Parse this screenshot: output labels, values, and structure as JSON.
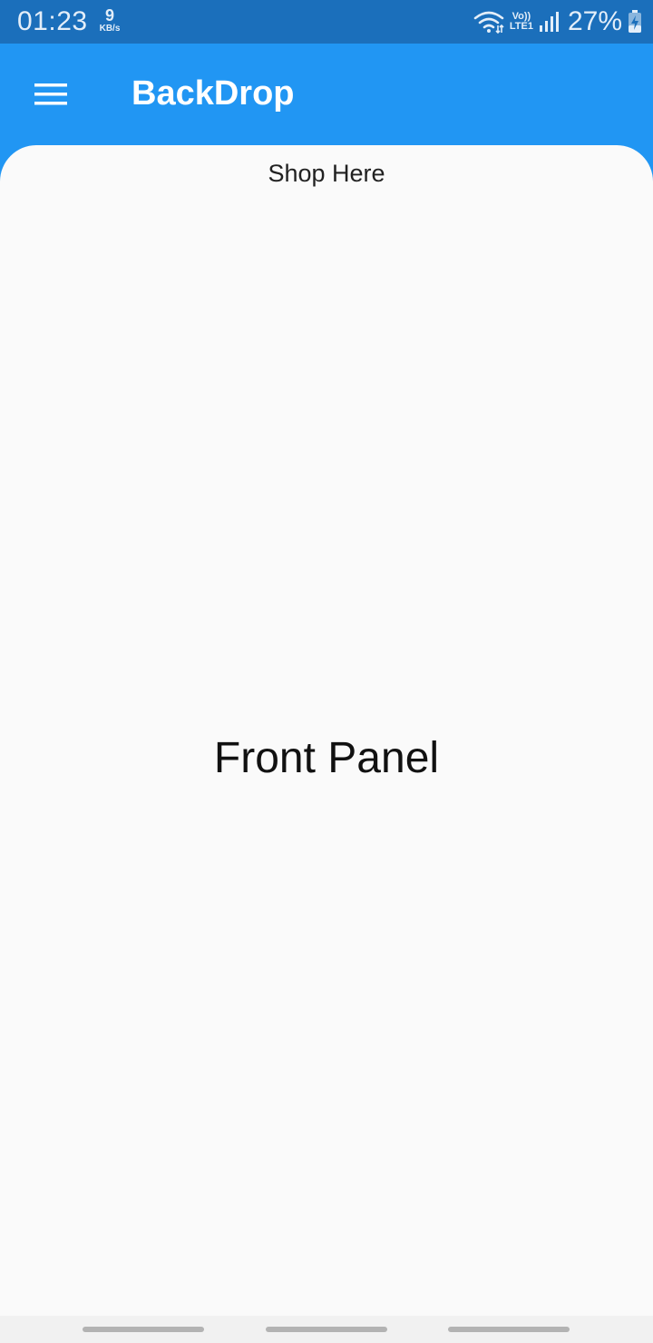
{
  "status_bar": {
    "time": "01:23",
    "net_speed_value": "9",
    "net_speed_unit": "KB/s",
    "volte_top": "Vo))",
    "volte_bottom": "LTE1",
    "battery_percent": "27%"
  },
  "app_bar": {
    "title": "BackDrop",
    "menu_icon": "hamburger-menu-icon"
  },
  "front_panel": {
    "header": "Shop Here",
    "body_text": "Front Panel"
  },
  "colors": {
    "primary": "#2196F3",
    "status_bar": "#1B6FBB",
    "panel_background": "#FAFAFA"
  }
}
